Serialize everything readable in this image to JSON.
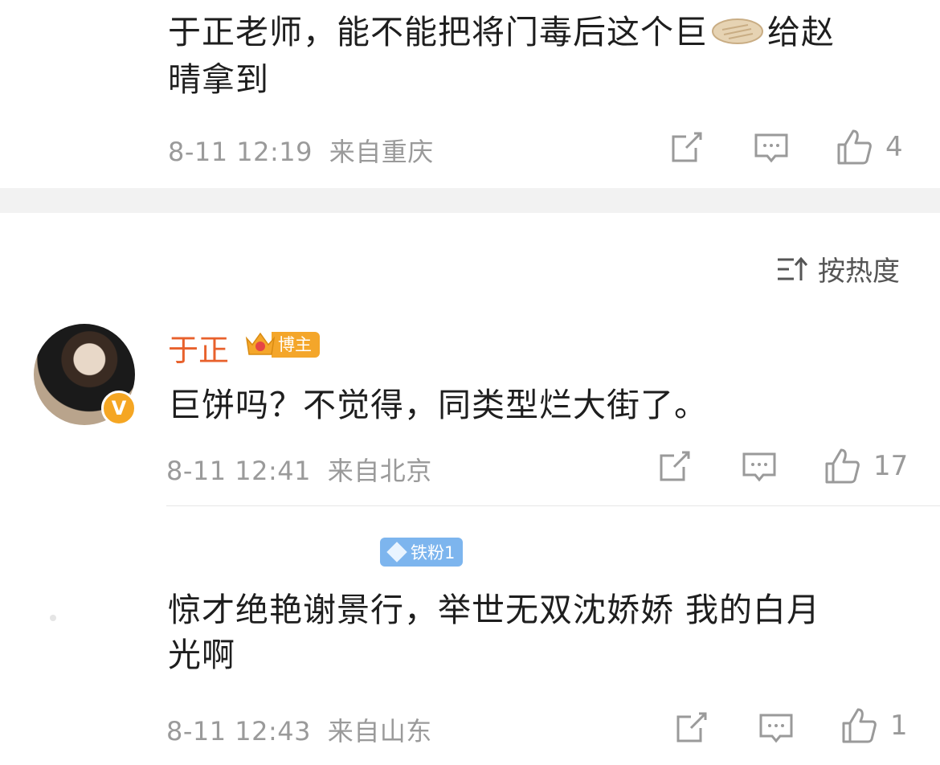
{
  "comments": [
    {
      "text_line1": "于正老师，能不能把将门毒后这个巨",
      "text_line1_suffix": "给赵",
      "text_line2": "晴拿到",
      "date": "8-11 12:19",
      "location": "来自重庆",
      "like_count": "4",
      "inline_emoji": "pancake-emoji"
    },
    {
      "username": "于正",
      "badge": "博主",
      "text": "巨饼吗？不觉得，同类型烂大街了。",
      "date": "8-11 12:41",
      "location": "来自北京",
      "like_count": "17"
    },
    {
      "fan_badge": "铁粉1",
      "text_line1": "惊才绝艳谢景行，举世无双沈娇娇 我的白月",
      "text_line2": "光啊",
      "date": "8-11 12:43",
      "location": "来自山东",
      "like_count": "1"
    }
  ],
  "sort": {
    "label": "按热度",
    "icon": "sort-icon"
  },
  "colors": {
    "username": "#e8612c",
    "badge": "#f4a62a",
    "fan_badge": "#7db5ee",
    "meta": "#9a9a9a",
    "separator": "#f2f2f2"
  }
}
